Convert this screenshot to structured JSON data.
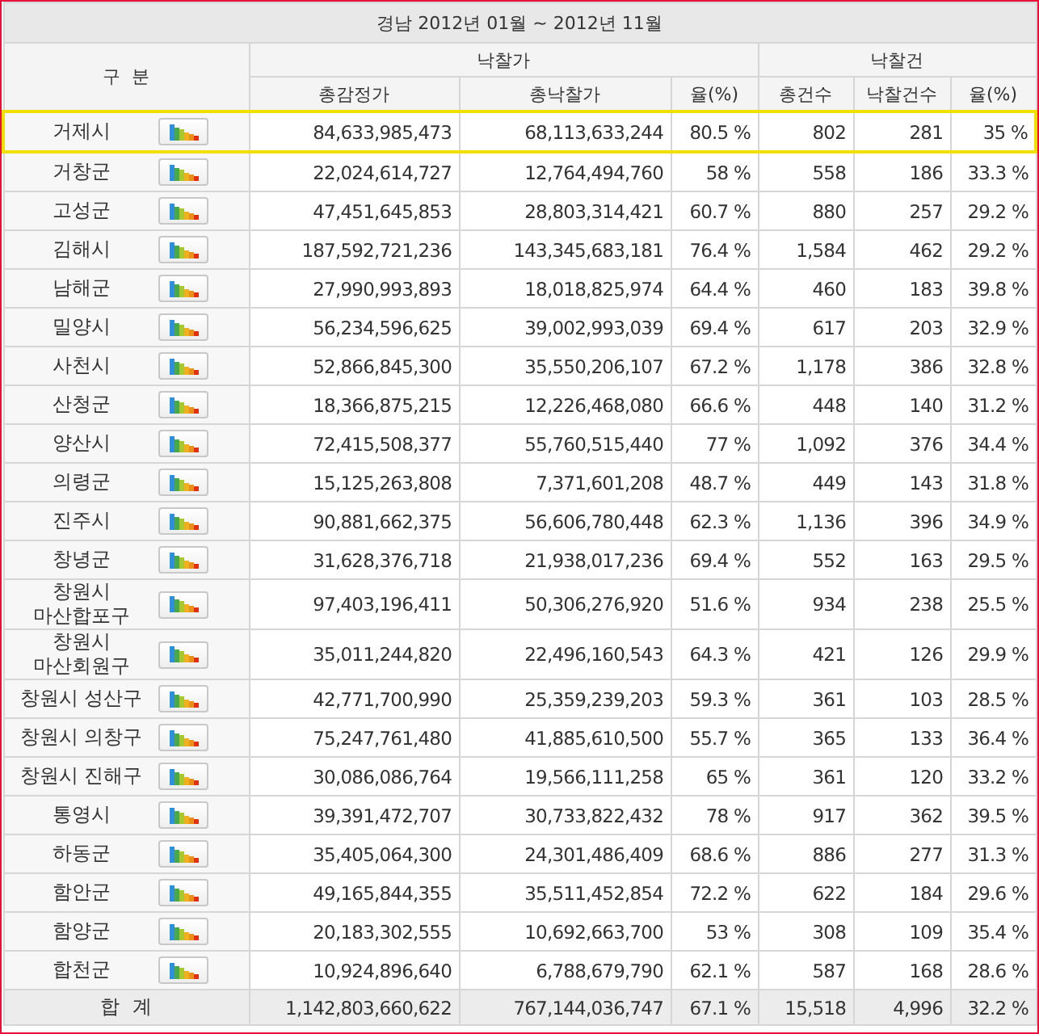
{
  "title": "경남 2012년 01월 ~ 2012년 11월",
  "header": {
    "category": "구  분",
    "group_price": "낙찰가",
    "group_count": "낙찰건",
    "columns": [
      "총감정가",
      "총낙찰가",
      "율(%)",
      "총건수",
      "낙찰건수",
      "율(%)"
    ]
  },
  "rows": [
    {
      "name": "거제시",
      "selected": true,
      "values": [
        "84,633,985,473",
        "68,113,633,244",
        "80.5 %",
        "802",
        "281",
        "35 %"
      ]
    },
    {
      "name": "거창군",
      "selected": false,
      "values": [
        "22,024,614,727",
        "12,764,494,760",
        "58 %",
        "558",
        "186",
        "33.3 %"
      ]
    },
    {
      "name": "고성군",
      "selected": false,
      "values": [
        "47,451,645,853",
        "28,803,314,421",
        "60.7 %",
        "880",
        "257",
        "29.2 %"
      ]
    },
    {
      "name": "김해시",
      "selected": false,
      "values": [
        "187,592,721,236",
        "143,345,683,181",
        "76.4 %",
        "1,584",
        "462",
        "29.2 %"
      ]
    },
    {
      "name": "남해군",
      "selected": false,
      "values": [
        "27,990,993,893",
        "18,018,825,974",
        "64.4 %",
        "460",
        "183",
        "39.8 %"
      ]
    },
    {
      "name": "밀양시",
      "selected": false,
      "values": [
        "56,234,596,625",
        "39,002,993,039",
        "69.4 %",
        "617",
        "203",
        "32.9 %"
      ]
    },
    {
      "name": "사천시",
      "selected": false,
      "values": [
        "52,866,845,300",
        "35,550,206,107",
        "67.2 %",
        "1,178",
        "386",
        "32.8 %"
      ]
    },
    {
      "name": "산청군",
      "selected": false,
      "values": [
        "18,366,875,215",
        "12,226,468,080",
        "66.6 %",
        "448",
        "140",
        "31.2 %"
      ]
    },
    {
      "name": "양산시",
      "selected": false,
      "values": [
        "72,415,508,377",
        "55,760,515,440",
        "77 %",
        "1,092",
        "376",
        "34.4 %"
      ]
    },
    {
      "name": "의령군",
      "selected": false,
      "values": [
        "15,125,263,808",
        "7,371,601,208",
        "48.7 %",
        "449",
        "143",
        "31.8 %"
      ]
    },
    {
      "name": "진주시",
      "selected": false,
      "values": [
        "90,881,662,375",
        "56,606,780,448",
        "62.3 %",
        "1,136",
        "396",
        "34.9 %"
      ]
    },
    {
      "name": "창녕군",
      "selected": false,
      "values": [
        "31,628,376,718",
        "21,938,017,236",
        "69.4 %",
        "552",
        "163",
        "29.5 %"
      ]
    },
    {
      "name": "창원시 마산합포구",
      "selected": false,
      "values": [
        "97,403,196,411",
        "50,306,276,920",
        "51.6 %",
        "934",
        "238",
        "25.5 %"
      ]
    },
    {
      "name": "창원시 마산회원구",
      "selected": false,
      "values": [
        "35,011,244,820",
        "22,496,160,543",
        "64.3 %",
        "421",
        "126",
        "29.9 %"
      ]
    },
    {
      "name": "창원시 성산구",
      "selected": false,
      "values": [
        "42,771,700,990",
        "25,359,239,203",
        "59.3 %",
        "361",
        "103",
        "28.5 %"
      ]
    },
    {
      "name": "창원시 의창구",
      "selected": false,
      "values": [
        "75,247,761,480",
        "41,885,610,500",
        "55.7 %",
        "365",
        "133",
        "36.4 %"
      ]
    },
    {
      "name": "창원시 진해구",
      "selected": false,
      "values": [
        "30,086,086,764",
        "19,566,111,258",
        "65 %",
        "361",
        "120",
        "33.2 %"
      ]
    },
    {
      "name": "통영시",
      "selected": false,
      "values": [
        "39,391,472,707",
        "30,733,822,432",
        "78 %",
        "917",
        "362",
        "39.5 %"
      ]
    },
    {
      "name": "하동군",
      "selected": false,
      "values": [
        "35,405,064,300",
        "24,301,486,409",
        "68.6 %",
        "886",
        "277",
        "31.3 %"
      ]
    },
    {
      "name": "함안군",
      "selected": false,
      "values": [
        "49,165,844,355",
        "35,511,452,854",
        "72.2 %",
        "622",
        "184",
        "29.6 %"
      ]
    },
    {
      "name": "함양군",
      "selected": false,
      "values": [
        "20,183,302,555",
        "10,692,663,700",
        "53 %",
        "308",
        "109",
        "35.4 %"
      ]
    },
    {
      "name": "합천군",
      "selected": false,
      "values": [
        "10,924,896,640",
        "6,788,679,790",
        "62.1 %",
        "587",
        "168",
        "28.6 %"
      ]
    }
  ],
  "total": {
    "label": "합  계",
    "values": [
      "1,142,803,660,622",
      "767,144,036,747",
      "67.1 %",
      "15,518",
      "4,996",
      "32.2 %"
    ]
  }
}
